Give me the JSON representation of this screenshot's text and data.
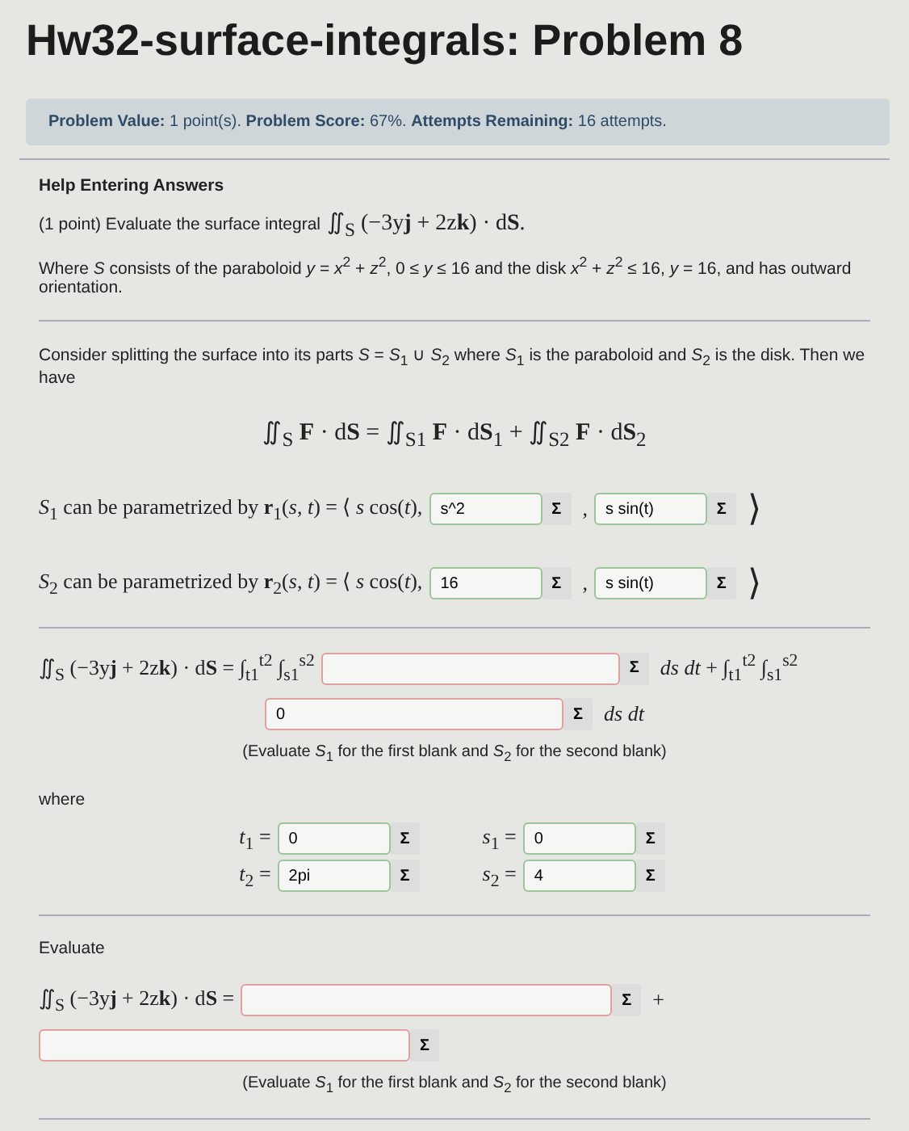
{
  "title": "Hw32-surface-integrals: Problem 8",
  "info_bar": [
    {
      "label": "Problem Value:",
      "value": "1 point(s)."
    },
    {
      "label": "Problem Score:",
      "value": "67%."
    },
    {
      "label": "Attempts Remaining:",
      "value": "16 attempts."
    }
  ],
  "help_link": "Help Entering Answers",
  "intro": {
    "text": "(1 point) Evaluate the surface integral",
    "formula": "∬$_{S}$ (−3y**j** + 2z**k**) · d**S**."
  },
  "description": "Where *S* consists of the paraboloid *y* = *x*$^{2}$ + *z*$^{2}$, 0 ≤ *y* ≤ 16 and the disk *x*$^{2}$ + *z*$^{2}$ ≤ 16, *y* = 16, and has outward orientation.",
  "split_text": "Consider splitting the surface into its parts *S* = *S*$_{1}$ ∪ *S*$_{2}$ where *S*$_{1}$ is the paraboloid and *S*$_{2}$ is the disk. Then we have",
  "split_formula": "∬$_{S}$ **F** · d**S** = ∬$_{S1}$ **F** · d**S**$_{1}$ + ∬$_{S2}$ **F** · d**S**$_{2}$",
  "parametrizations": [
    {
      "prefix": "*S*$_{1}$ can be parametrized by **r**$_{1}$(*s*, *t*) = ⟨ *s* cos(*t*),",
      "separator": ",",
      "close": "⟩",
      "fields": [
        {
          "value": "s^2",
          "correct": true,
          "button": "Σ"
        },
        {
          "value": "s sin(t)",
          "correct": true,
          "button": "Σ"
        }
      ]
    },
    {
      "prefix": "*S*$_{2}$ can be parametrized by **r**$_{2}$(*s*, *t*) = ⟨ *s* cos(*t*),",
      "separator": ",",
      "close": "⟩",
      "fields": [
        {
          "value": "16",
          "correct": true,
          "button": "Σ"
        },
        {
          "value": "s sin(t)",
          "correct": true,
          "button": "Σ"
        }
      ]
    }
  ],
  "setup": {
    "lhs": "∬$_{S}$ (−3y**j** + 2z**k**) · d**S** = ∫$_{t1}$$^{t2}$ ∫$_{s1}$$^{s2}$",
    "field_1": {
      "correct": false,
      "button": "Σ"
    },
    "mid": "*ds dt* + ∫$_{t1}$$^{t2}$ ∫$_{s1}$$^{s2}$",
    "field_2": {
      "value": "0",
      "correct": false,
      "button": "Σ"
    },
    "end": "*ds dt*",
    "note": "(Evaluate *S*$_{1}$ for the first blank and *S*$_{2}$ for the second blank)"
  },
  "where_label": "where",
  "limits": [
    {
      "label": "*t*$_{1}$ =",
      "field": {
        "value": "0",
        "correct": true,
        "button": "Σ"
      }
    },
    {
      "label": "*s*$_{1}$ =",
      "field": {
        "value": "0",
        "correct": true,
        "button": "Σ"
      }
    },
    {
      "label": "*t*$_{2}$ =",
      "field": {
        "value": "2pi",
        "correct": true,
        "button": "Σ"
      }
    },
    {
      "label": "*s*$_{2}$ =",
      "field": {
        "value": "4",
        "correct": true,
        "button": "Σ"
      }
    }
  ],
  "evaluate_label": "Evaluate",
  "final": {
    "lhs": "∬$_{S}$ (−3y**j** + 2z**k**) · d**S** =",
    "field_1": {
      "correct": false,
      "button": "Σ"
    },
    "plus": "+",
    "field_2": {
      "correct": false,
      "button": "Σ"
    },
    "note": "(Evaluate *S*$_{1}$ for the first blank and *S*$_{2}$ for the second blank)"
  }
}
